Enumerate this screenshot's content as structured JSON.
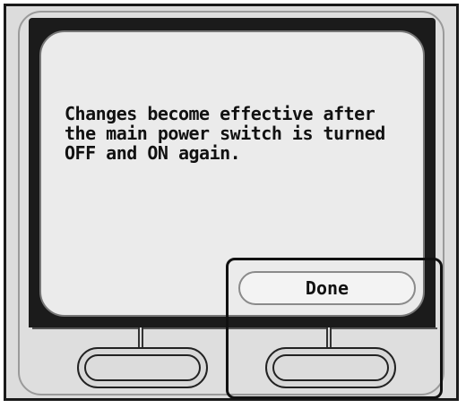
{
  "screen": {
    "message": "Changes become effective after\nthe main power switch is turned\nOFF and ON again.",
    "done_label": "Done"
  }
}
